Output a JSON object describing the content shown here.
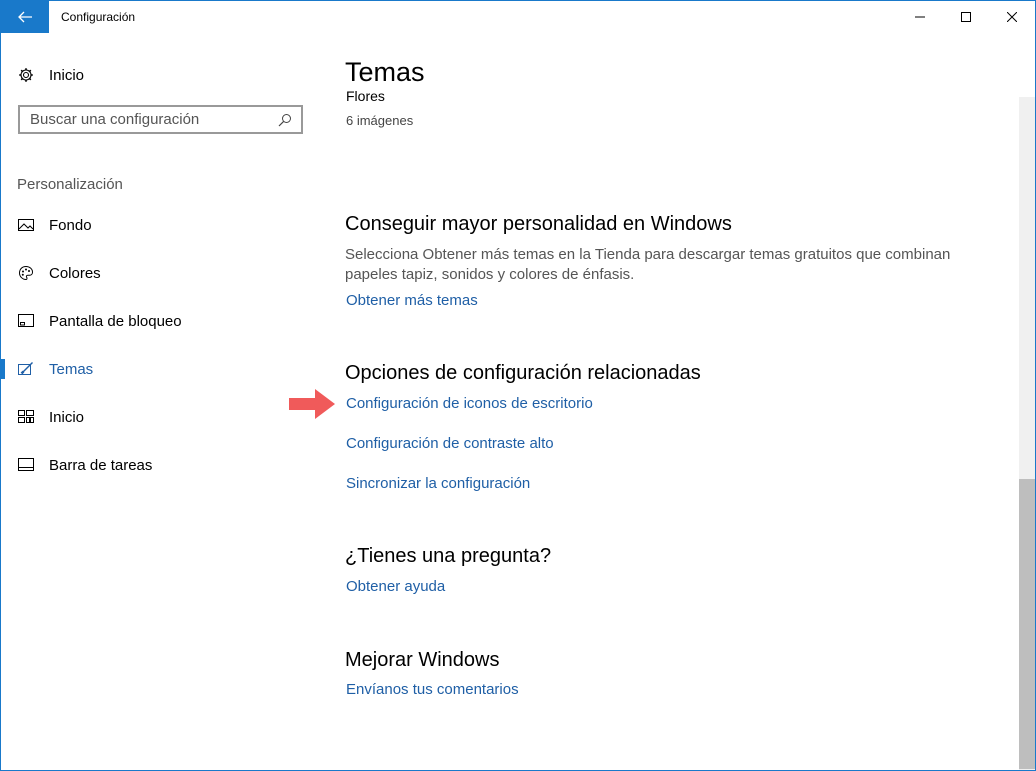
{
  "window": {
    "title": "Configuración",
    "accent": "#1979ca",
    "controls": {
      "minimize": "minimize-icon",
      "maximize": "maximize-icon",
      "close": "close-icon"
    }
  },
  "sidebar": {
    "home": {
      "label": "Inicio",
      "icon": "gear-icon"
    },
    "search": {
      "placeholder": "Buscar una configuración",
      "value": "",
      "icon": "search-icon"
    },
    "section_label": "Personalización",
    "items": [
      {
        "label": "Fondo",
        "icon": "picture-icon",
        "active": false
      },
      {
        "label": "Colores",
        "icon": "palette-icon",
        "active": false
      },
      {
        "label": "Pantalla de bloqueo",
        "icon": "lock-screen-icon",
        "active": false
      },
      {
        "label": "Temas",
        "icon": "themes-brush-icon",
        "active": true
      },
      {
        "label": "Inicio",
        "icon": "start-tiles-icon",
        "active": false
      },
      {
        "label": "Barra de tareas",
        "icon": "taskbar-icon",
        "active": false
      }
    ]
  },
  "main": {
    "title": "Temas",
    "theme": {
      "name": "Flores",
      "count": "6 imágenes"
    },
    "get_more": {
      "heading": "Conseguir mayor personalidad en Windows",
      "description": "Selecciona Obtener más temas en la Tienda para descargar temas gratuitos que combinan papeles tapiz, sonidos y colores de énfasis.",
      "link": "Obtener más temas"
    },
    "related": {
      "heading": "Opciones de configuración relacionadas",
      "links": [
        "Configuración de iconos de escritorio",
        "Configuración de contraste alto",
        "Sincronizar la configuración"
      ]
    },
    "question": {
      "heading": "¿Tienes una pregunta?",
      "link": "Obtener ayuda"
    },
    "improve": {
      "heading": "Mejorar Windows",
      "link": "Envíanos tus comentarios"
    }
  },
  "annotation": {
    "icon": "red-arrow-icon",
    "color": "#f05a5a"
  }
}
